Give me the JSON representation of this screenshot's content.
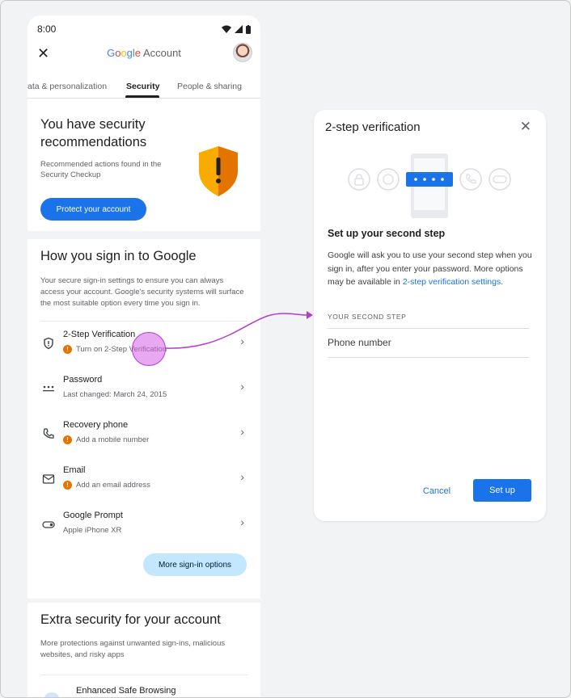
{
  "status": {
    "time": "8:00"
  },
  "header": {
    "brand_google": [
      "G",
      "o",
      "o",
      "g",
      "l",
      "e"
    ],
    "brand_account": "Account"
  },
  "tabs": [
    {
      "label": "ata & personalization",
      "active": false
    },
    {
      "label": "Security",
      "active": true
    },
    {
      "label": "People & sharing",
      "active": false
    }
  ],
  "recommendations": {
    "title": "You have security recommendations",
    "description": "Recommended actions found in the Security Checkup",
    "button": "Protect your account"
  },
  "signin": {
    "title": "How you sign in to Google",
    "description": "Your secure sign-in settings to ensure you can always access your account. Google's security systems will surface the most suitable option every time you sign in.",
    "rows": [
      {
        "icon": "shield-icon",
        "title": "2-Step Verification",
        "sub": "Turn on 2-Step Verification",
        "warning": true
      },
      {
        "icon": "password-dots-icon",
        "title": "Password",
        "sub": "Last changed: March 24, 2015",
        "warning": false
      },
      {
        "icon": "phone-icon",
        "title": "Recovery phone",
        "sub": "Add a mobile number",
        "warning": true
      },
      {
        "icon": "mail-icon",
        "title": "Email",
        "sub": "Add an email address",
        "warning": true
      },
      {
        "icon": "device-toggle-icon",
        "title": "Google Prompt",
        "sub": "Apple iPhone XR",
        "warning": false
      }
    ],
    "more_button": "More sign-in options"
  },
  "extra": {
    "title": "Extra security for your account",
    "description": "More protections against unwanted sign-ins, malicious websites, and risky apps",
    "item": "Enhanced Safe Browsing"
  },
  "dialog": {
    "title": "2-step verification",
    "heading": "Set up your second step",
    "body_text": "Google will ask you to use your second step when you sign in, after you enter your password. More options may be available in ",
    "body_link": "2-step verification settings",
    "body_end": ".",
    "section_label": "YOUR SECOND STEP",
    "option": "Phone number",
    "cancel": "Cancel",
    "setup": "Set up"
  },
  "colors": {
    "accent": "#1a73e8",
    "warning": "#e37400",
    "highlight": "#d660e8",
    "arrow": "#b63bd0"
  }
}
